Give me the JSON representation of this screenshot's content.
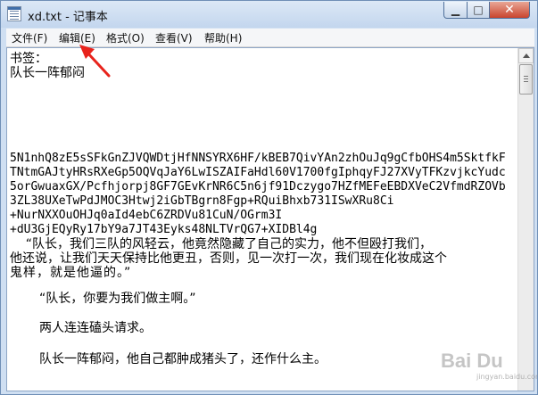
{
  "window": {
    "title": "xd.txt - 记事本",
    "minimize_glyph": "▁",
    "maximize_glyph": "□",
    "close_glyph": "✕",
    "app_icon": "notepad-icon"
  },
  "menu": {
    "items": [
      {
        "label": "文件(F)"
      },
      {
        "label": "编辑(E)"
      },
      {
        "label": "格式(O)"
      },
      {
        "label": "查看(V)"
      },
      {
        "label": "帮助(H)"
      }
    ]
  },
  "document": {
    "lines": [
      "书签：",
      "队长一阵郁闷",
      "5N1nhQ8zE5sSFkGnZJVQWDtjHfNNSYRX6HF/kBEB7QivYAn2zhOuJq9gCfbOHS4m5SktfkF",
      "TNtmGAJtyHRsRXeGp5OQVqJaY6LwISZAIFaHdl60V1700fgIphqyFJ27XVyTFKzvjkcYudc",
      "5orGwuaxGX/Pcfhjorpj8GF7GEvKrNR6C5n6jf91Dczygo7HZfMEFeEBDXVeC2VfmdRZOVb",
      "3ZL38UXeTwPdJMOC3Htwj2iGbTBgrn8Fgp+RQuiBhxb731ISwXRu8Ci",
      "+NurNXXOuOHJq0aId4ebC6ZRDVu81CuN/OGrm3I",
      "+dU3GjEQyRy17bY9a7JT43Eyks48NLTVrQG7+XIDBl4g",
      "    “队长，我们三队的风轻云，他竟然隐藏了自己的实力，他不但殴打我们，",
      "他还说，让我们天天保持比他更丑，否则，见一次打一次，我们现在化妆成这个",
      "鬼样，就是他逼的。”",
      "“队长，你要为我们做主啊。”",
      "两人连连磕头请求。",
      "队长一阵郁闷，他自己都肿成猪头了，还作什么主。"
    ]
  },
  "annotation": {
    "arrow_color": "#e8231c"
  },
  "watermark": {
    "text": "Bai Du",
    "sub": "jingyan.baidu.com"
  }
}
